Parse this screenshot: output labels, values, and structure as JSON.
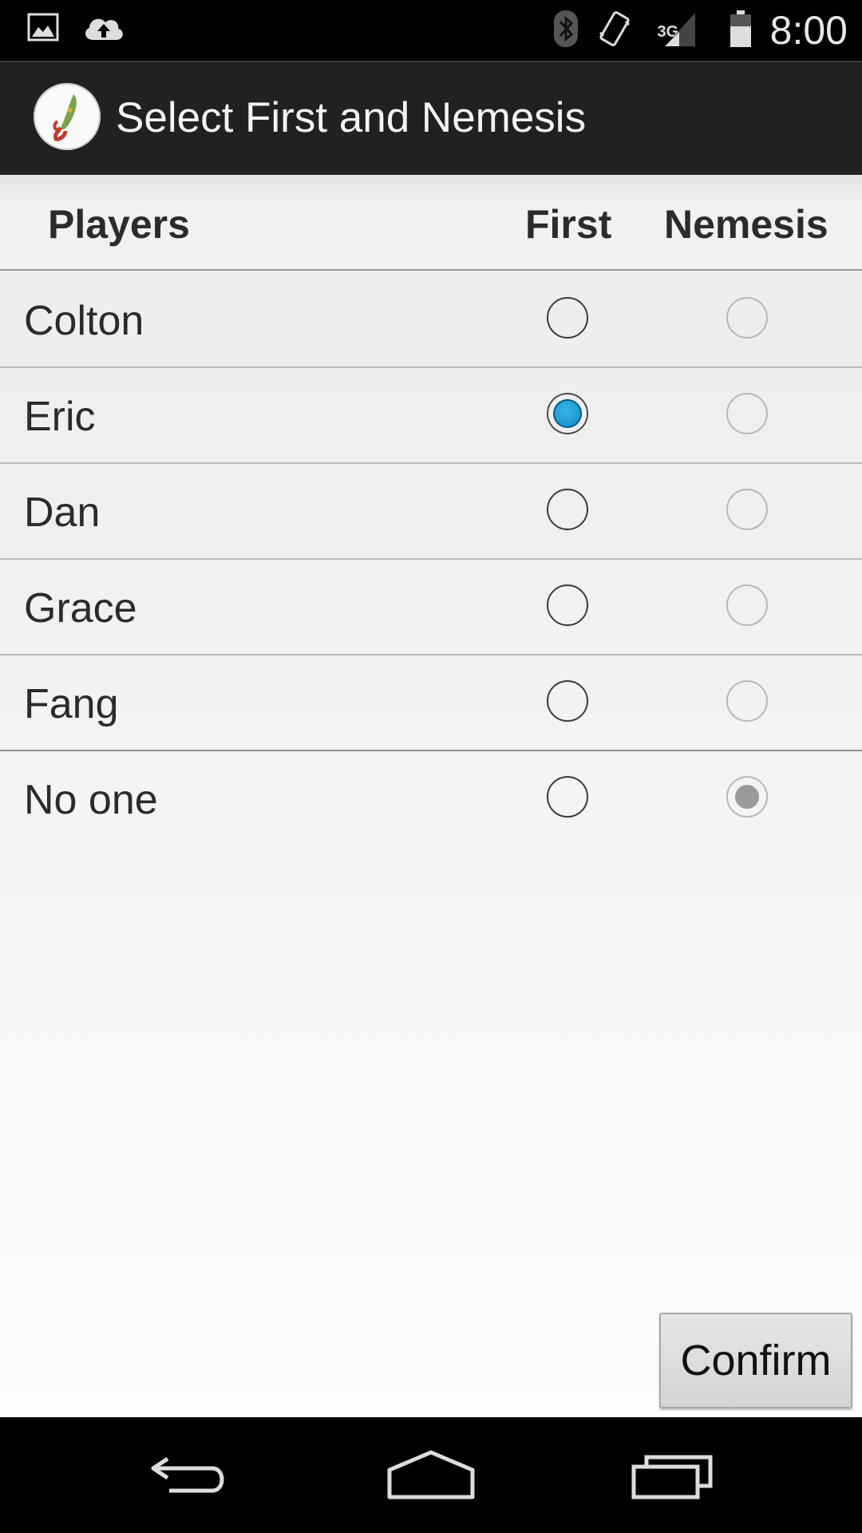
{
  "status_bar": {
    "time": "8:00",
    "network": "3G",
    "icons": [
      "image-notification-icon",
      "cloud-upload-icon",
      "bluetooth-icon",
      "vibrate-icon",
      "signal-icon",
      "battery-icon"
    ]
  },
  "action_bar": {
    "title": "Select First and Nemesis",
    "icon": "app-logo-icon"
  },
  "table": {
    "headers": {
      "players": "Players",
      "first": "First",
      "nemesis": "Nemesis"
    },
    "rows": [
      {
        "name": "Colton",
        "first_selected": false,
        "nemesis_selected": false
      },
      {
        "name": "Eric",
        "first_selected": true,
        "nemesis_selected": false
      },
      {
        "name": "Dan",
        "first_selected": false,
        "nemesis_selected": false
      },
      {
        "name": "Grace",
        "first_selected": false,
        "nemesis_selected": false
      },
      {
        "name": "Fang",
        "first_selected": false,
        "nemesis_selected": false
      },
      {
        "name": "No one",
        "first_selected": false,
        "nemesis_selected": true
      }
    ]
  },
  "confirm_label": "Confirm",
  "colors": {
    "accent": "#0b8ac5",
    "action_bar": "#212121",
    "status_bar": "#000000"
  },
  "nav_bar": {
    "icons": [
      "back-icon",
      "home-icon",
      "recent-apps-icon"
    ]
  }
}
